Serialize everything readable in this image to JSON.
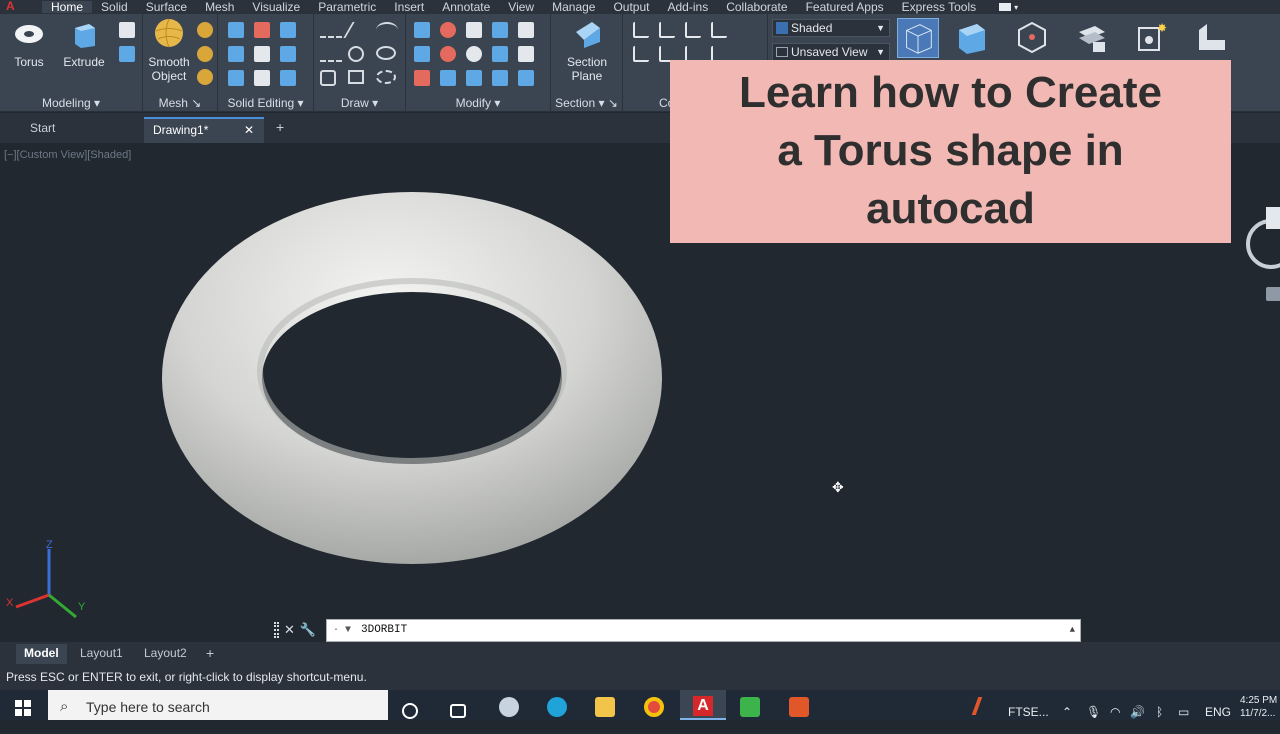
{
  "menubar": {
    "tabs": [
      "Home",
      "Solid",
      "Surface",
      "Mesh",
      "Visualize",
      "Parametric",
      "Insert",
      "Annotate",
      "View",
      "Manage",
      "Output",
      "Add-ins",
      "Collaborate",
      "Featured Apps",
      "Express Tools"
    ],
    "active_tab": "Home"
  },
  "ribbon": {
    "modeling": {
      "title": "Modeling",
      "torus_label": "Torus",
      "extrude_label": "Extrude"
    },
    "mesh": {
      "title": "Mesh",
      "smooth_label_1": "Smooth",
      "smooth_label_2": "Object"
    },
    "solid_editing": {
      "title": "Solid Editing"
    },
    "draw": {
      "title": "Draw"
    },
    "modify": {
      "title": "Modify"
    },
    "section": {
      "title": "Section",
      "plane_label_1": "Section",
      "plane_label_2": "Plane"
    },
    "coordinates": {
      "title": "Co"
    },
    "view": {
      "visual_style": "Shaded",
      "named_view": "Unsaved View"
    }
  },
  "file_tabs": {
    "start": "Start",
    "drawing": "Drawing1*",
    "add": "+"
  },
  "viewport": {
    "view_label": "[−][Custom View][Shaded]",
    "ucs": {
      "z": "Z",
      "x": "X",
      "y": "Y"
    }
  },
  "banner": {
    "line1": "Learn how to Create",
    "line2": "a Torus shape in",
    "line3": "autocad"
  },
  "command_line": {
    "value": "3DORBIT"
  },
  "layout_tabs": {
    "model": "Model",
    "layout1": "Layout1",
    "layout2": "Layout2",
    "add": "+"
  },
  "status_bar": {
    "message": "Press ESC or ENTER to exit, or right-click to display shortcut-menu."
  },
  "taskbar": {
    "search_placeholder": "Type here to search",
    "tray_app": "FTSE...",
    "language": "ENG",
    "time": "4:25 PM",
    "date": "11/7/2..."
  },
  "colors": {
    "viewport_bg": "#212830",
    "ribbon_bg": "#3b4552",
    "banner_bg": "#f2b8b3",
    "torus": "#d7d8d6"
  }
}
